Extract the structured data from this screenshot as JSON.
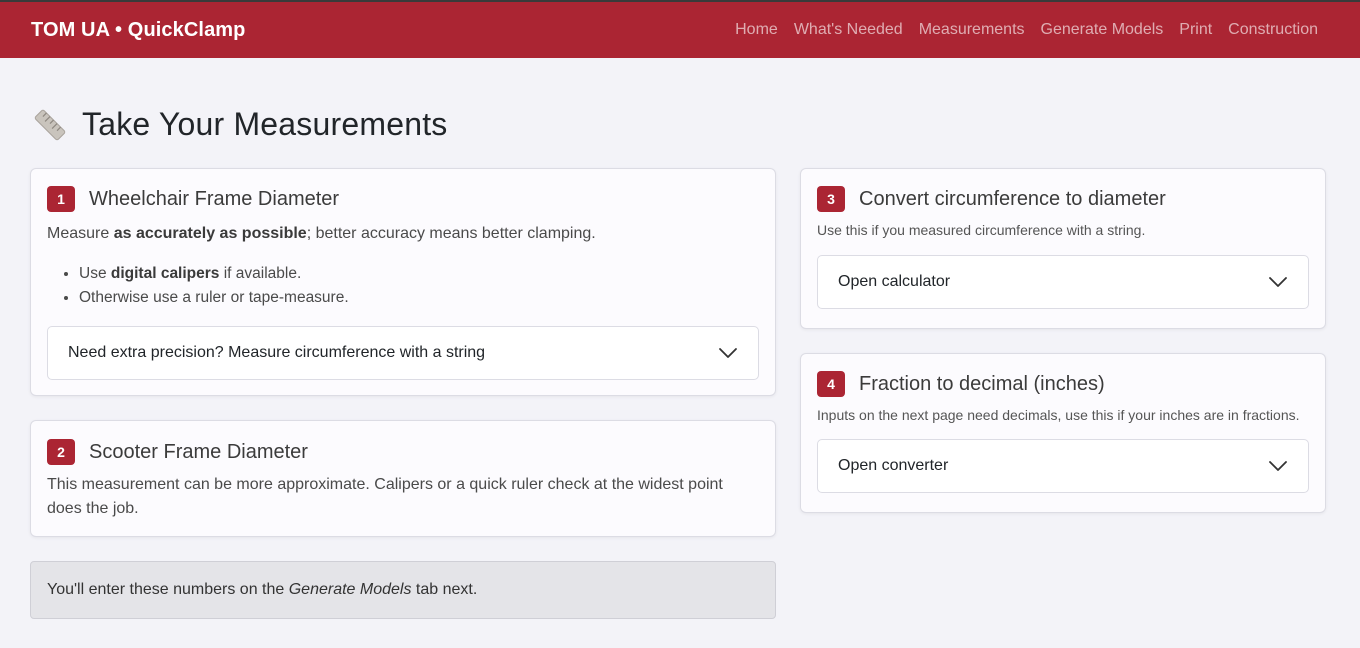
{
  "navbar": {
    "brand": "TOM UA • QuickClamp",
    "links": [
      "Home",
      "What's Needed",
      "Measurements",
      "Generate Models",
      "Print",
      "Construction"
    ]
  },
  "page": {
    "title": "Take Your Measurements",
    "title_icon": "ruler-icon"
  },
  "card1": {
    "step": "1",
    "title": "Wheelchair Frame Diameter",
    "text_pre": "Measure ",
    "text_bold": "as accurately as possible",
    "text_post": "; better accuracy means better clamping.",
    "bullet1_pre": "Use ",
    "bullet1_bold": "digital calipers",
    "bullet1_post": " if available.",
    "bullet2": "Otherwise use a ruler or tape-measure.",
    "details_label": "Need extra precision? Measure circumference with a string"
  },
  "card2": {
    "step": "2",
    "title": "Scooter Frame Diameter",
    "text": "This measurement can be more approximate. Calipers or a quick ruler check at the widest point does the job."
  },
  "card3": {
    "step": "3",
    "title": "Convert circumference to diameter",
    "text": "Use this if you measured circumference with a string.",
    "details_label": "Open calculator"
  },
  "card4": {
    "step": "4",
    "title": "Fraction to decimal (inches)",
    "text": "Inputs on the next page need decimals, use this if your inches are in fractions.",
    "details_label": "Open converter"
  },
  "note": {
    "pre": "You'll enter these numbers on the ",
    "em": "Generate Models",
    "post": " tab next."
  },
  "colors": {
    "brand": "#ab2533",
    "background": "#f3f3f8",
    "card": "#fcfbfe"
  }
}
